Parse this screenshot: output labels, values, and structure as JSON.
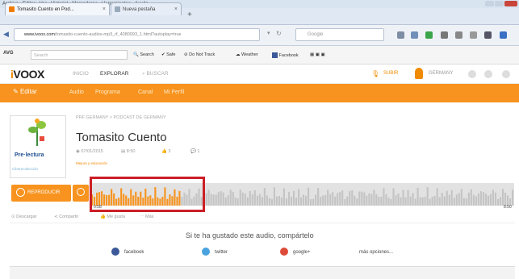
{
  "browser": {
    "menu": [
      "Archivo",
      "Editar",
      "Ver",
      "Historial",
      "Marcadores",
      "Herramientas",
      "Ayuda"
    ],
    "tabs": [
      {
        "label": "Tomasito Cuento en Pod...",
        "active": true
      },
      {
        "label": "Nueva pestaña",
        "active": false
      }
    ],
    "new_tab": "+",
    "url_host": "www.ivoox.com",
    "url_rest": "/tomasito-cuento-audios-mp3_rf_4080093_1.html?autoplay=true",
    "search_placeholder": "Google"
  },
  "toolbar": {
    "avg": "AVG",
    "search_placeholder": "Search",
    "search_label": "Search",
    "safe": "Safe",
    "dnt": "Do Not Track",
    "weather": "Weather",
    "facebook": "Facebook"
  },
  "header": {
    "logo_prefix": "i",
    "logo_rest": "VOOX",
    "nav": [
      "INICIO",
      "EXPLORAR",
      "BUSCAR"
    ],
    "subir": "SUBIR",
    "user": "GERMANY"
  },
  "orange_bar": {
    "edit": "Editar",
    "links": [
      "Audio",
      "Programa",
      "Canal",
      "Mi Perfil"
    ]
  },
  "podcast": {
    "poster_title": "Pre·lectura",
    "poster_foot": "Ciberecolección",
    "breadcrumb": "PRF GERMANY  >  PODCAST DE GERMANY",
    "title": "Tomasito Cuento",
    "plays": "07/01/2015",
    "duration": "8:50",
    "likes": "3",
    "comments": "1",
    "tag": "Mejora y educación"
  },
  "player": {
    "play_label": "REPRODUCIR",
    "current_time": "0:58",
    "end_time": "8:50",
    "progress": 0.21
  },
  "actions": [
    "Descargar",
    "Compartir",
    "Me gusta",
    "Más"
  ],
  "share": {
    "heading": "Si te ha gustado este audio, compártelo",
    "facebook": "facebook",
    "twitter": "twitter",
    "google": "google+",
    "more": "más opciones..."
  },
  "colors": {
    "accent": "#f7931e",
    "highlight": "#cc1f27"
  }
}
